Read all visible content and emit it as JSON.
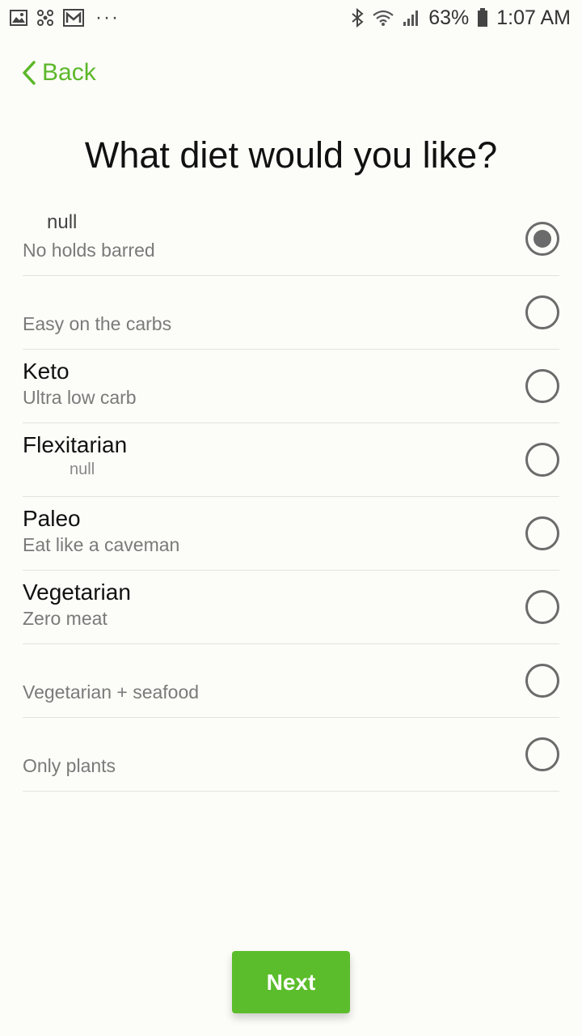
{
  "status_bar": {
    "battery": "63%",
    "time": "1:07 AM",
    "overflow": "···",
    "icons_left": [
      "image-icon",
      "share-icon",
      "mail-icon"
    ],
    "icons_right": [
      "bluetooth-icon",
      "wifi-icon",
      "signal-icon",
      "battery-icon"
    ]
  },
  "header": {
    "back_label": "Back"
  },
  "title": "What diet would you like?",
  "options": [
    {
      "name": "null",
      "desc": "No holds barred",
      "selected": true
    },
    {
      "name": "",
      "desc": "Easy on the carbs",
      "selected": false
    },
    {
      "name": "Keto",
      "desc": "Ultra low carb",
      "selected": false
    },
    {
      "name": "Flexitarian",
      "desc": "null",
      "selected": false
    },
    {
      "name": "Paleo",
      "desc": "Eat like a caveman",
      "selected": false
    },
    {
      "name": "Vegetarian",
      "desc": "Zero meat",
      "selected": false
    },
    {
      "name": "",
      "desc": "Vegetarian + seafood",
      "selected": false
    },
    {
      "name": "",
      "desc": "Only plants",
      "selected": false
    }
  ],
  "next_label": "Next",
  "colors": {
    "accent": "#5bbd2b",
    "background": "#fcfcf8",
    "radio": "#6b6b6b"
  }
}
